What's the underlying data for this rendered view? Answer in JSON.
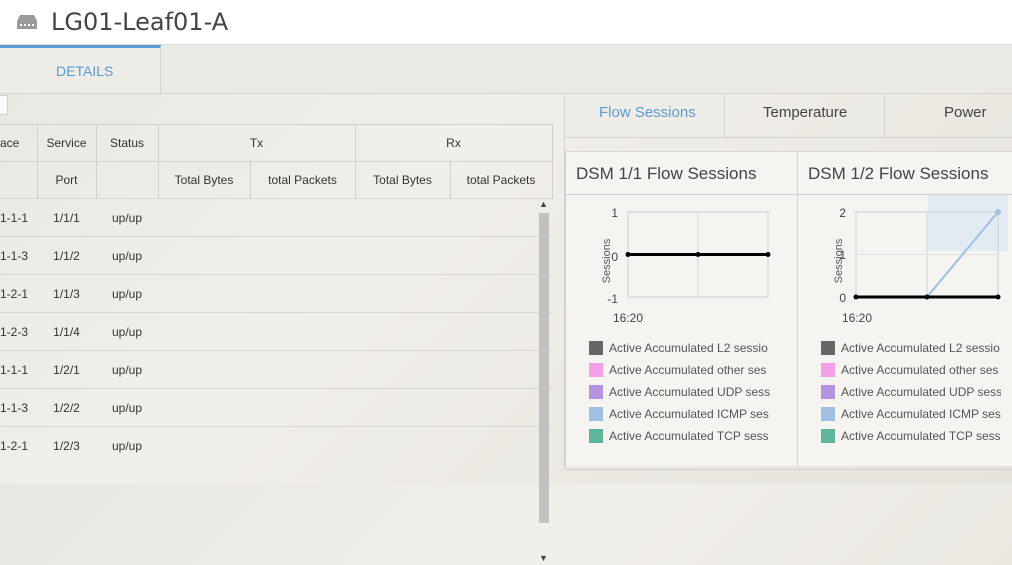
{
  "header": {
    "title": "LG01-Leaf01-A",
    "icon": "switch-icon"
  },
  "tabs": {
    "details_label": "DETAILS"
  },
  "table": {
    "group_headers": {
      "interface": "ace",
      "service": "Service",
      "status": "Status",
      "tx": "Tx",
      "rx": "Rx"
    },
    "sub_headers": {
      "port": "Port",
      "tx_bytes": "Total Bytes",
      "tx_packets": "total Packets",
      "rx_bytes": "Total Bytes",
      "rx_packets": "total Packets"
    },
    "rows": [
      {
        "iface": "1-1-1",
        "port": "1/1/1",
        "status": "up/up"
      },
      {
        "iface": "1-1-3",
        "port": "1/1/2",
        "status": "up/up"
      },
      {
        "iface": "1-2-1",
        "port": "1/1/3",
        "status": "up/up"
      },
      {
        "iface": "1-2-3",
        "port": "1/1/4",
        "status": "up/up"
      },
      {
        "iface": "1-1-1",
        "port": "1/2/1",
        "status": "up/up"
      },
      {
        "iface": "1-1-3",
        "port": "1/2/2",
        "status": "up/up"
      },
      {
        "iface": "1-2-1",
        "port": "1/2/3",
        "status": "up/up"
      }
    ]
  },
  "right_tabs": [
    "Flow Sessions",
    "Temperature",
    "Power"
  ],
  "cards": [
    {
      "title": "DSM 1/1 Flow Sessions",
      "ylabel": "Sessions",
      "yticks": [
        "1",
        "0",
        "-1"
      ],
      "xtick": "16:20",
      "legend": [
        {
          "label": "Active Accumulated L2 sessio",
          "color": "#666666"
        },
        {
          "label": "Active Accumulated other ses",
          "color": "#f3a0e8"
        },
        {
          "label": "Active Accumulated UDP sess",
          "color": "#b593e0"
        },
        {
          "label": "Active Accumulated ICMP ses",
          "color": "#9fbfe3"
        },
        {
          "label": "Active Accumulated TCP sess",
          "color": "#5fb49c"
        }
      ]
    },
    {
      "title": "DSM 1/2 Flow Sessions",
      "ylabel": "Sessions",
      "yticks": [
        "2",
        "1",
        "0"
      ],
      "xtick": "16:20",
      "legend": [
        {
          "label": "Active Accumulated L2 sessio",
          "color": "#666666"
        },
        {
          "label": "Active Accumulated other ses",
          "color": "#f3a0e8"
        },
        {
          "label": "Active Accumulated UDP sess",
          "color": "#b593e0"
        },
        {
          "label": "Active Accumulated ICMP ses",
          "color": "#9fbfe3"
        },
        {
          "label": "Active Accumulated TCP sess",
          "color": "#5fb49c"
        }
      ]
    }
  ],
  "chart_data": [
    {
      "type": "line",
      "title": "DSM 1/1 Flow Sessions",
      "ylabel": "Sessions",
      "ylim": [
        -1,
        1
      ],
      "x": [
        0,
        1,
        2
      ],
      "xtick_label": "16:20",
      "series": [
        {
          "name": "Active Accumulated L2 sessio",
          "values": [
            0,
            0,
            0
          ]
        }
      ]
    },
    {
      "type": "line",
      "title": "DSM 1/2 Flow Sessions",
      "ylabel": "Sessions",
      "ylim": [
        0,
        2
      ],
      "x": [
        0,
        1,
        2
      ],
      "xtick_label": "16:20",
      "series": [
        {
          "name": "Active Accumulated L2 sessio",
          "values": [
            0,
            0,
            0
          ]
        },
        {
          "name": "Active Accumulated ICMP ses",
          "values": [
            0,
            0,
            2
          ]
        }
      ]
    }
  ]
}
